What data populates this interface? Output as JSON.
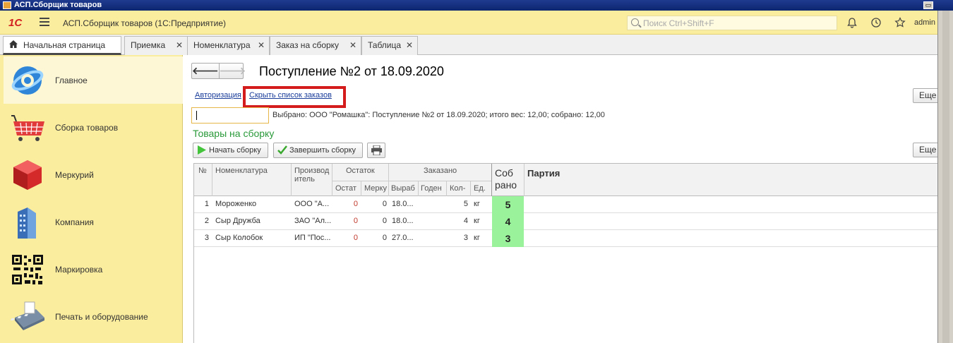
{
  "window": {
    "title": "АСП.Сборщик товаров"
  },
  "header": {
    "logo": "1С",
    "app_title": "АСП.Сборщик товаров  (1С:Предприятие)",
    "search_placeholder": "Поиск Ctrl+Shift+F",
    "user": "admin"
  },
  "tabs": [
    {
      "label": "Начальная страница",
      "active": true
    },
    {
      "label": "Приемка"
    },
    {
      "label": "Номенклатура"
    },
    {
      "label": "Заказ на сборку"
    },
    {
      "label": "Таблица"
    }
  ],
  "sidebar": {
    "items": [
      {
        "label": "Главное",
        "icon": "main-section-icon"
      },
      {
        "label": "Сборка товаров",
        "icon": "basket-icon"
      },
      {
        "label": "Меркурий",
        "icon": "cube-icon"
      },
      {
        "label": "Компания",
        "icon": "building-icon"
      },
      {
        "label": "Маркировка",
        "icon": "qr-code-icon"
      },
      {
        "label": "Печать и оборудование",
        "icon": "payment-terminal-icon"
      }
    ]
  },
  "doc": {
    "title": "Поступление №2 от 18.09.2020",
    "link_auth": "Авторизация",
    "link_hide_orders": "Скрыть список заказов",
    "more_label": "Еще",
    "selected_info": "Выбрано: ООО \"Ромашка\": Поступление №2 от 18.09.2020; итого вес: 12,00; собрано: 12,00",
    "section_title": "Товары на сборку",
    "btn_start": "Начать сборку",
    "btn_finish": "Завершить сборку"
  },
  "table": {
    "headers": {
      "num": "№",
      "nom": "Номенклатура",
      "maker_1": "Производ",
      "maker_2": "итель",
      "remain": "Остаток",
      "ordered": "Заказано",
      "collected_1": "Соб",
      "collected_2": "рано",
      "batch": "Партия",
      "remain_stock": "Остат",
      "remain_mercury": "Мерку",
      "ord_produced": "Выраб",
      "ord_valid": "Годен",
      "ord_qty": "Кол-",
      "ord_unit": "Ед."
    },
    "rows": [
      {
        "num": "1",
        "nom": "Мороженко",
        "maker": "ООО \"А...",
        "stock": "0",
        "mercury": "0",
        "produced": "18.0...",
        "valid": "",
        "qty": "5",
        "unit": "кг",
        "collected": "5"
      },
      {
        "num": "2",
        "nom": "Сыр Дружба",
        "maker": "ЗАО \"Ал...",
        "stock": "0",
        "mercury": "0",
        "produced": "18.0...",
        "valid": "",
        "qty": "4",
        "unit": "кг",
        "collected": "4"
      },
      {
        "num": "3",
        "nom": "Сыр Колобок",
        "maker": "ИП \"Пос...",
        "stock": "0",
        "mercury": "0",
        "produced": "27.0...",
        "valid": "",
        "qty": "3",
        "unit": "кг",
        "collected": "3"
      }
    ]
  },
  "colors": {
    "header_bg": "#fbed9e",
    "highlight_red": "#d51c1c",
    "collected_green": "#9af29b",
    "section_green": "#2a9a3a",
    "link_blue": "#1a3d9a"
  }
}
